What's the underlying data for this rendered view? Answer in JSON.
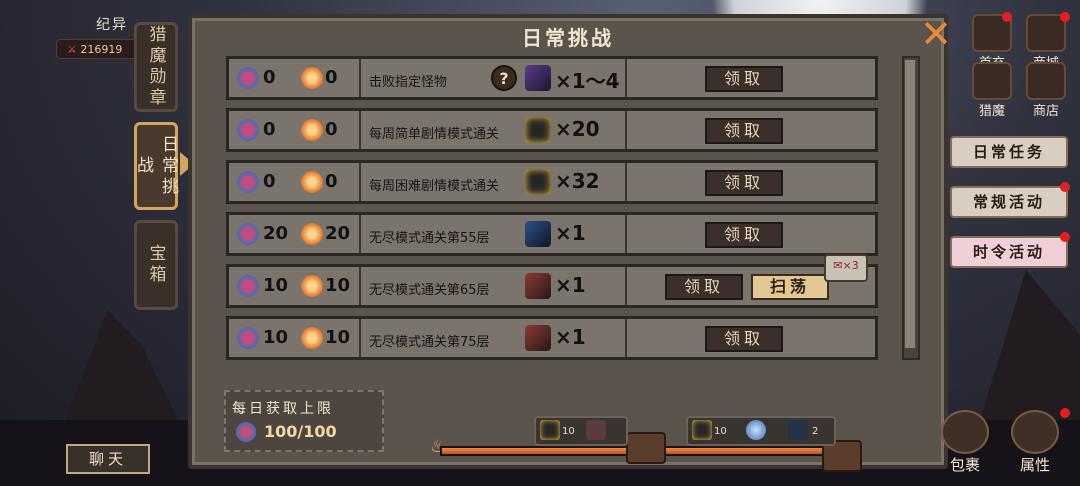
{
  "player": {
    "name": "纪异",
    "power": "216919"
  },
  "panel": {
    "title": "日常挑战"
  },
  "tabs": [
    {
      "label": "猎魔勋章",
      "active": false
    },
    {
      "label": "日常挑战",
      "active": true
    },
    {
      "label": "宝箱",
      "active": false
    }
  ],
  "rows": [
    {
      "reward_a": "0",
      "reward_b": "0",
      "desc": "击败指定怪物",
      "item": "dark-crystal-icon",
      "qty": "×1～4",
      "buttons": [
        "领取"
      ]
    },
    {
      "reward_a": "0",
      "reward_b": "0",
      "desc": "每周简单剧情模式通关",
      "item": "lantern-box-icon",
      "qty": "×20",
      "buttons": [
        "领取"
      ]
    },
    {
      "reward_a": "0",
      "reward_b": "0",
      "desc": "每周困难剧情模式通关",
      "item": "lantern-box-icon",
      "qty": "×32",
      "buttons": [
        "领取"
      ]
    },
    {
      "reward_a": "20",
      "reward_b": "20",
      "desc": "无尽模式通关第55层",
      "item": "blue-weapon-icon",
      "qty": "×1",
      "buttons": [
        "领取"
      ]
    },
    {
      "reward_a": "10",
      "reward_b": "10",
      "desc": "无尽模式通关第65层",
      "item": "red-staff-icon",
      "qty": "×1",
      "buttons": [
        "领取",
        "扫荡"
      ]
    },
    {
      "reward_a": "10",
      "reward_b": "10",
      "desc": "无尽模式通关第75层",
      "item": "red-staff-icon",
      "qty": "×1",
      "buttons": [
        "领取"
      ]
    }
  ],
  "daily_limit": {
    "label": "每日获取上限",
    "value": "100/100"
  },
  "progress": {
    "fraction": 0.97
  },
  "milestones": [
    {
      "items": [
        {
          "icon": "lantern-box-icon",
          "count": "10"
        },
        {
          "icon": "red-staff-icon",
          "count": ""
        }
      ]
    },
    {
      "items": [
        {
          "icon": "lantern-box-icon",
          "count": "10"
        },
        {
          "icon": "blue-gem-icon",
          "count": ""
        },
        {
          "icon": "blue-weapon-icon",
          "count": "2"
        }
      ]
    }
  ],
  "chat": {
    "label": "聊天"
  },
  "right_menu": {
    "shouchong": "首充",
    "shangcheng": "商城",
    "liemo": "猎魔",
    "shangdian": "商店"
  },
  "side_buttons": {
    "daily_tasks": "日常任务",
    "regular_events": "常规活动",
    "limited_events": "时令活动"
  },
  "bottom": {
    "bag": "包裹",
    "attributes": "属性"
  },
  "colors": {
    "accent": "#e98a3a",
    "panel": "#5b544c",
    "row": "#7b746c",
    "alert": "#e12020"
  }
}
